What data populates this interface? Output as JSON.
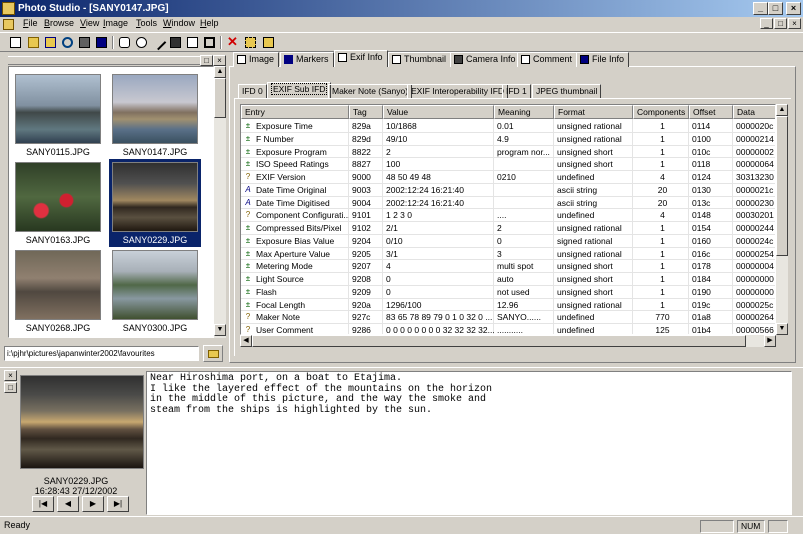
{
  "window": {
    "title": "Photo Studio - [SANY0147.JPG]"
  },
  "menu": [
    {
      "label": "File",
      "u": "F",
      "rest": "ile"
    },
    {
      "label": "Browse",
      "u": "B",
      "rest": "rowse"
    },
    {
      "label": "View",
      "u": "V",
      "rest": "iew"
    },
    {
      "label": "Image",
      "u": "I",
      "rest": "mage"
    },
    {
      "label": "Tools",
      "u": "T",
      "rest": "ools"
    },
    {
      "label": "Window",
      "u": "W",
      "rest": "indow"
    },
    {
      "label": "Help",
      "u": "H",
      "rest": "elp"
    }
  ],
  "thumbnails": [
    {
      "name": "SANY0115.JPG"
    },
    {
      "name": "SANY0147.JPG"
    },
    {
      "name": "SANY0163.JPG"
    },
    {
      "name": "SANY0229.JPG",
      "selected": true
    },
    {
      "name": "SANY0268.JPG"
    },
    {
      "name": "SANY0300.JPG"
    }
  ],
  "path": "i:\\pjhr\\pictures\\japanwinter2002\\favourites",
  "tabs": [
    "Image",
    "Markers",
    "Exif Info",
    "Thumbnail",
    "Camera Info",
    "Comment",
    "File Info"
  ],
  "active_tab": "Exif Info",
  "subtabs": [
    "IFD 0",
    "EXIF Sub IFD",
    "Maker Note (Sanyo)",
    "EXIF Interoperability IFD",
    "IFD 1",
    "JPEG thumbnail"
  ],
  "active_subtab": "EXIF Sub IFD",
  "table": {
    "columns": [
      "Entry",
      "Tag",
      "Value",
      "Meaning",
      "Format",
      "Components",
      "Offset",
      "Data"
    ],
    "rows": [
      {
        "icon": "plus-minus",
        "entry": "Exposure Time",
        "tag": "829a",
        "value": "10/1868",
        "meaning": "0.01",
        "format": "unsigned rational",
        "components": "1",
        "offset": "0114",
        "data": "0000020c"
      },
      {
        "icon": "plus-minus",
        "entry": "F Number",
        "tag": "829d",
        "value": "49/10",
        "meaning": "4.9",
        "format": "unsigned rational",
        "components": "1",
        "offset": "0100",
        "data": "00000214"
      },
      {
        "icon": "plus-minus",
        "entry": "Exposure Program",
        "tag": "8822",
        "value": "2",
        "meaning": "program nor...",
        "format": "unsigned short",
        "components": "1",
        "offset": "010c",
        "data": "00000002"
      },
      {
        "icon": "plus-minus",
        "entry": "ISO Speed Ratings",
        "tag": "8827",
        "value": "100",
        "meaning": "",
        "format": "unsigned short",
        "components": "1",
        "offset": "0118",
        "data": "00000064"
      },
      {
        "icon": "info",
        "entry": "EXIF Version",
        "tag": "9000",
        "value": "48 50 49 48",
        "meaning": "0210",
        "format": "undefined",
        "components": "4",
        "offset": "0124",
        "data": "30313230"
      },
      {
        "icon": "text",
        "entry": "Date Time Original",
        "tag": "9003",
        "value": "2002:12:24 16:21:40",
        "meaning": "",
        "format": "ascii string",
        "components": "20",
        "offset": "0130",
        "data": "0000021c"
      },
      {
        "icon": "text",
        "entry": "Date Time Digitised",
        "tag": "9004",
        "value": "2002:12:24 16:21:40",
        "meaning": "",
        "format": "ascii string",
        "components": "20",
        "offset": "013c",
        "data": "00000230"
      },
      {
        "icon": "info",
        "entry": "Component Configurati...",
        "tag": "9101",
        "value": "1 2 3 0",
        "meaning": "....",
        "format": "undefined",
        "components": "4",
        "offset": "0148",
        "data": "00030201"
      },
      {
        "icon": "plus-minus",
        "entry": "Compressed Bits/Pixel",
        "tag": "9102",
        "value": "2/1",
        "meaning": "2",
        "format": "unsigned rational",
        "components": "1",
        "offset": "0154",
        "data": "00000244"
      },
      {
        "icon": "plus-minus",
        "entry": "Exposure Bias Value",
        "tag": "9204",
        "value": "0/10",
        "meaning": "0",
        "format": "signed rational",
        "components": "1",
        "offset": "0160",
        "data": "0000024c"
      },
      {
        "icon": "plus-minus",
        "entry": "Max Aperture Value",
        "tag": "9205",
        "value": "3/1",
        "meaning": "3",
        "format": "unsigned rational",
        "components": "1",
        "offset": "016c",
        "data": "00000254"
      },
      {
        "icon": "plus-minus",
        "entry": "Metering Mode",
        "tag": "9207",
        "value": "4",
        "meaning": "multi spot",
        "format": "unsigned short",
        "components": "1",
        "offset": "0178",
        "data": "00000004"
      },
      {
        "icon": "plus-minus",
        "entry": "Light Source",
        "tag": "9208",
        "value": "0",
        "meaning": "auto",
        "format": "unsigned short",
        "components": "1",
        "offset": "0184",
        "data": "00000000"
      },
      {
        "icon": "plus-minus",
        "entry": "Flash",
        "tag": "9209",
        "value": "0",
        "meaning": "not used",
        "format": "unsigned short",
        "components": "1",
        "offset": "0190",
        "data": "00000000"
      },
      {
        "icon": "plus-minus",
        "entry": "Focal Length",
        "tag": "920a",
        "value": "1296/100",
        "meaning": "12.96",
        "format": "unsigned rational",
        "components": "1",
        "offset": "019c",
        "data": "0000025c"
      },
      {
        "icon": "info",
        "entry": "Maker Note",
        "tag": "927c",
        "value": "83 65 78 89 79 0 1 0 32 0 ...",
        "meaning": "SANYO......",
        "format": "undefined",
        "components": "770",
        "offset": "01a8",
        "data": "00000264"
      },
      {
        "icon": "info",
        "entry": "User Comment",
        "tag": "9286",
        "value": "0 0 0 0 0 0 0 0 32 32 32 32...",
        "meaning": "...........",
        "format": "undefined",
        "components": "125",
        "offset": "01b4",
        "data": "00000566"
      }
    ]
  },
  "preview": {
    "filename": "SANY0229.JPG",
    "datetime": "16:28:43 27/12/2002"
  },
  "comment_lines": [
    "Near Hiroshima port, on a boat to Etajima.",
    "I like the layered effect of the mountains on the horizon",
    "in the middle of this picture, and the way the smoke and",
    "steam from the ships is highlighted by the sun."
  ],
  "status": {
    "text": "Ready",
    "num": "NUM"
  }
}
